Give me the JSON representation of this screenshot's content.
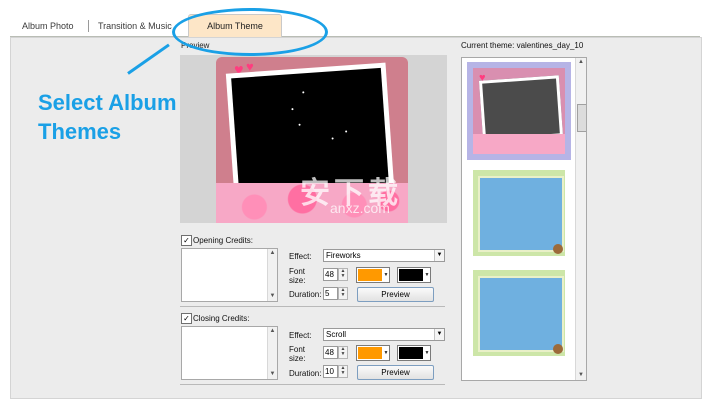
{
  "tabs": [
    {
      "label": "Album Photo"
    },
    {
      "label": "Transition & Music"
    },
    {
      "label": "Album Theme"
    }
  ],
  "annotation": {
    "line1": "Select Album",
    "line2": "Themes"
  },
  "preview": {
    "label": "Preview"
  },
  "watermark": {
    "main": "安下载",
    "sub": "anxz.com"
  },
  "opening_credits": {
    "label": "Opening Credits:",
    "checked": "✓",
    "effect_label": "Effect:",
    "effect_value": "Fireworks",
    "font_size_label": "Font size:",
    "font_size_value": "48",
    "duration_label": "Duration:",
    "duration_value": "5",
    "text_color": "#ff9900",
    "bg_color": "#000000",
    "preview_button": "Preview"
  },
  "closing_credits": {
    "label": "Closing Credits:",
    "checked": "✓",
    "effect_label": "Effect:",
    "effect_value": "Scroll",
    "font_size_label": "Font size:",
    "font_size_value": "48",
    "duration_label": "Duration:",
    "duration_value": "10",
    "text_color": "#ff9900",
    "bg_color": "#000000",
    "preview_button": "Preview"
  },
  "themes": {
    "current_label": "Current theme: valentines_day_10",
    "selected_index": 0
  },
  "colors": {
    "accent": "#1aa0e6",
    "active_tab": "#fde6c7"
  }
}
